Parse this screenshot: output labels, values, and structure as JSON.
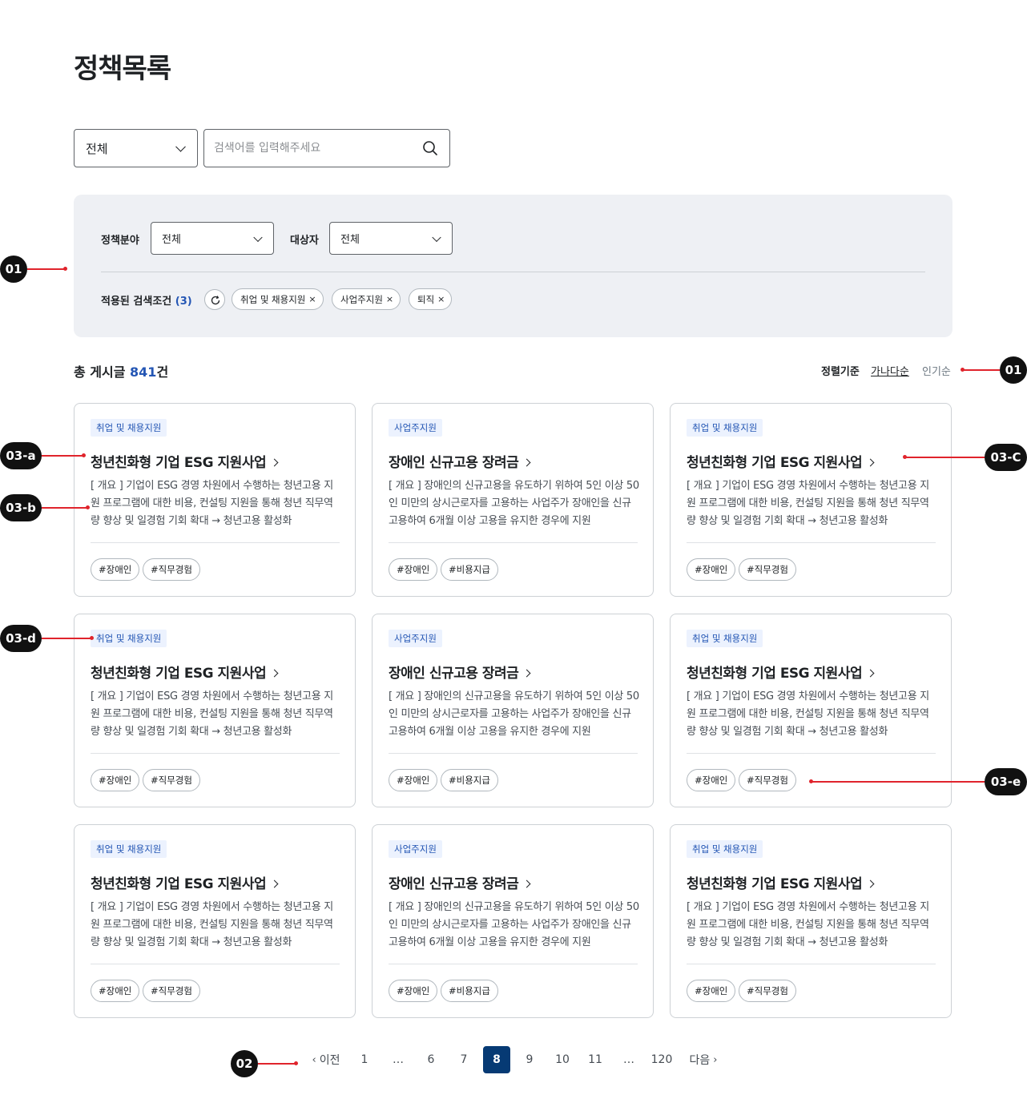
{
  "page_title": "정책목록",
  "search": {
    "category_value": "전체",
    "placeholder": "검색어를 입력해주세요"
  },
  "filters": {
    "field_label": "정책분야",
    "field_value": "전체",
    "target_label": "대상자",
    "target_value": "전체",
    "applied_label": "적용된 검색조건",
    "applied_count": "(3)",
    "chips": [
      "취업 및 채용지원",
      "사업주지원",
      "퇴직"
    ],
    "chip_remove": "×"
  },
  "results": {
    "total_prefix": "총 게시글 ",
    "total_count": "841",
    "total_suffix": "건",
    "sort_label": "정렬기준",
    "sort_options": [
      "가나다순",
      "인기순"
    ]
  },
  "cards": [
    {
      "category": "취업 및 채용지원",
      "title": "청년친화형 기업 ESG 지원사업",
      "desc": "[ 개요 ] 기업이 ESG 경영 차원에서 수행하는 청년고용 지원 프로그램에 대한 비용, 컨설팅 지원을 통해 청년 직무역량 향상 및 일경험 기회 확대 → 청년고용 활성화",
      "tags": [
        "#장애인",
        "#직무경험"
      ]
    },
    {
      "category": "사업주지원",
      "title": "장애인 신규고용 장려금",
      "desc": "[ 개요 ] 장애인의 신규고용을 유도하기 위하여 5인 이상 50인 미만의 상시근로자를 고용하는 사업주가 장애인을 신규고용하여 6개월 이상 고용을 유지한 경우에 지원",
      "tags": [
        "#장애인",
        "#비용지급"
      ]
    },
    {
      "category": "취업 및 채용지원",
      "title": "청년친화형 기업 ESG 지원사업",
      "desc": "[ 개요 ] 기업이 ESG 경영 차원에서 수행하는 청년고용 지원 프로그램에 대한 비용, 컨설팅 지원을 통해 청년 직무역량 향상 및 일경험 기회 확대 → 청년고용 활성화",
      "tags": [
        "#장애인",
        "#직무경험"
      ]
    },
    {
      "category": "취업 및 채용지원",
      "title": "청년친화형 기업 ESG 지원사업",
      "desc": "[ 개요 ] 기업이 ESG 경영 차원에서 수행하는 청년고용 지원 프로그램에 대한 비용, 컨설팅 지원을 통해 청년 직무역량 향상 및 일경험 기회 확대 → 청년고용 활성화",
      "tags": [
        "#장애인",
        "#직무경험"
      ]
    },
    {
      "category": "사업주지원",
      "title": "장애인 신규고용 장려금",
      "desc": "[ 개요 ] 장애인의 신규고용을 유도하기 위하여 5인 이상 50인 미만의 상시근로자를 고용하는 사업주가 장애인을 신규고용하여 6개월 이상 고용을 유지한 경우에 지원",
      "tags": [
        "#장애인",
        "#비용지급"
      ]
    },
    {
      "category": "취업 및 채용지원",
      "title": "청년친화형 기업 ESG 지원사업",
      "desc": "[ 개요 ] 기업이 ESG 경영 차원에서 수행하는 청년고용 지원 프로그램에 대한 비용, 컨설팅 지원을 통해 청년 직무역량 향상 및 일경험 기회 확대 → 청년고용 활성화",
      "tags": [
        "#장애인",
        "#직무경험"
      ]
    },
    {
      "category": "취업 및 채용지원",
      "title": "청년친화형 기업 ESG 지원사업",
      "desc": "[ 개요 ] 기업이 ESG 경영 차원에서 수행하는 청년고용 지원 프로그램에 대한 비용, 컨설팅 지원을 통해 청년 직무역량 향상 및 일경험 기회 확대 → 청년고용 활성화",
      "tags": [
        "#장애인",
        "#직무경험"
      ]
    },
    {
      "category": "사업주지원",
      "title": "장애인 신규고용 장려금",
      "desc": "[ 개요 ] 장애인의 신규고용을 유도하기 위하여 5인 이상 50인 미만의 상시근로자를 고용하는 사업주가 장애인을 신규고용하여 6개월 이상 고용을 유지한 경우에 지원",
      "tags": [
        "#장애인",
        "#비용지급"
      ]
    },
    {
      "category": "취업 및 채용지원",
      "title": "청년친화형 기업 ESG 지원사업",
      "desc": "[ 개요 ] 기업이 ESG 경영 차원에서 수행하는 청년고용 지원 프로그램에 대한 비용, 컨설팅 지원을 통해 청년 직무역량 향상 및 일경험 기회 확대 → 청년고용 활성화",
      "tags": [
        "#장애인",
        "#직무경험"
      ]
    }
  ],
  "pagination": {
    "prev": "이전",
    "next": "다음",
    "pages": [
      "1",
      "…",
      "6",
      "7",
      "8",
      "9",
      "10",
      "11",
      "…",
      "120"
    ],
    "current": "8"
  },
  "annotations": [
    "01",
    "01",
    "02",
    "03-a",
    "03-b",
    "03-C",
    "03-d",
    "03-e"
  ],
  "colors": {
    "accent": "#2456b4",
    "active_page": "#063a74",
    "panel_bg": "#eef0f4",
    "badge_bg": "#ecf2fe",
    "annotation_line": "#e0242c"
  }
}
